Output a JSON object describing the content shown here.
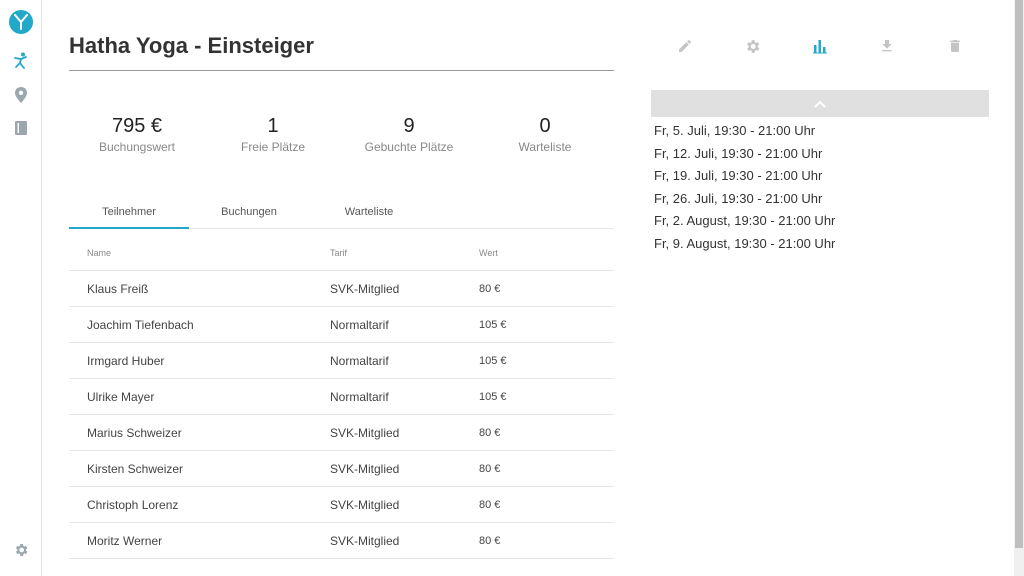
{
  "page": {
    "title": "Hatha Yoga - Einsteiger"
  },
  "stats": [
    {
      "value": "795 €",
      "label": "Buchungswert"
    },
    {
      "value": "1",
      "label": "Freie Plätze"
    },
    {
      "value": "9",
      "label": "Gebuchte Plätze"
    },
    {
      "value": "0",
      "label": "Warteliste"
    }
  ],
  "tabs": [
    {
      "label": "Teilnehmer",
      "active": true
    },
    {
      "label": "Buchungen",
      "active": false
    },
    {
      "label": "Warteliste",
      "active": false
    }
  ],
  "table": {
    "headers": [
      "Name",
      "Tarif",
      "Wert"
    ],
    "rows": [
      [
        "Klaus Freiß",
        "SVK-Mitglied",
        "80 €"
      ],
      [
        "Joachim Tiefenbach",
        "Normaltarif",
        "105 €"
      ],
      [
        "Irmgard Huber",
        "Normaltarif",
        "105 €"
      ],
      [
        "Ulrike Mayer",
        "Normaltarif",
        "105 €"
      ],
      [
        "Marius Schweizer",
        "SVK-Mitglied",
        "80 €"
      ],
      [
        "Kirsten Schweizer",
        "SVK-Mitglied",
        "80 €"
      ],
      [
        "Christoph Lorenz",
        "SVK-Mitglied",
        "80 €"
      ],
      [
        "Moritz Werner",
        "SVK-Mitglied",
        "80 €"
      ]
    ]
  },
  "dates": [
    "Fr, 5. Juli, 19:30 - 21:00 Uhr",
    "Fr, 12. Juli, 19:30 - 21:00 Uhr",
    "Fr, 19. Juli, 19:30 - 21:00 Uhr",
    "Fr, 26. Juli, 19:30 - 21:00 Uhr",
    "Fr, 2. August, 19:30 - 21:00 Uhr",
    "Fr, 9. August, 19:30 - 21:00 Uhr"
  ],
  "icons": {
    "sidebar": [
      "logo-icon",
      "yoga-pose-icon",
      "location-pin-icon",
      "book-icon",
      "gear-icon"
    ],
    "toolbar": [
      "pencil-icon",
      "gear-icon",
      "bar-chart-icon",
      "download-icon",
      "trash-icon"
    ]
  },
  "colors": {
    "accent": "#22a8c9",
    "icon_gray": "#c4c4c4",
    "sidebar_icon": "#9aa7ad"
  }
}
